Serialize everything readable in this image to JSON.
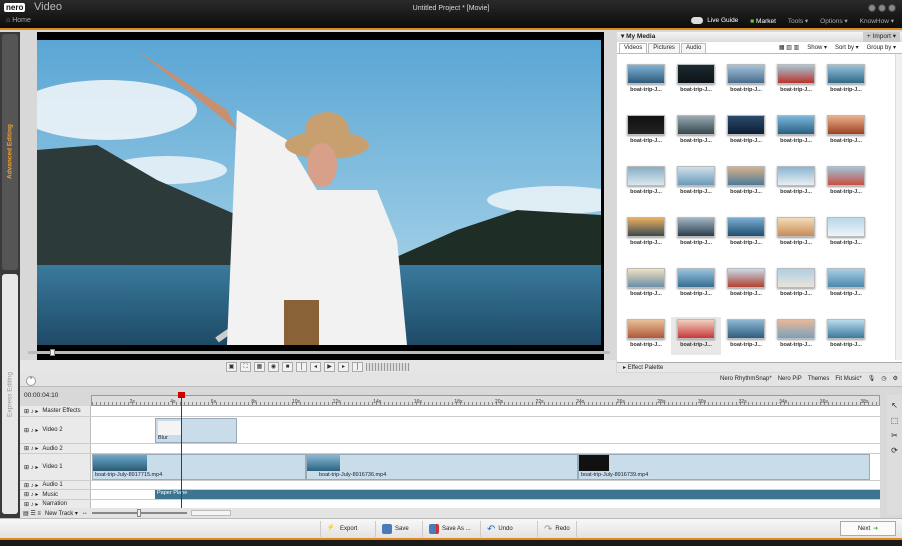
{
  "titlebar": {
    "brand": "nero",
    "app": "Video",
    "home": "Home",
    "window_title": "Untitled Project * [Movie]",
    "menu": [
      "Live Guide",
      "Market",
      "Tools ▾",
      "Options ▾",
      "KnowHow ▾"
    ]
  },
  "left_tabs": {
    "advanced": "Advanced Editing",
    "express": "Express Editing"
  },
  "media": {
    "title": "▾ My Media",
    "import": "+ Import ▾",
    "tabs": [
      "Videos",
      "Pictures",
      "Audio"
    ],
    "options": [
      "Show ▾",
      "Sort by ▾",
      "Group by ▾"
    ],
    "items": [
      {
        "label": "boat-trip-J...",
        "c1": "#7fb4d6",
        "c2": "#2e5a7a"
      },
      {
        "label": "boat-trip-J...",
        "c1": "#1c2a30",
        "c2": "#0c1418"
      },
      {
        "label": "boat-trip-J...",
        "c1": "#a8c4dc",
        "c2": "#476c8c"
      },
      {
        "label": "boat-trip-J...",
        "c1": "#a8c8d8",
        "c2": "#b8342a"
      },
      {
        "label": "boat-trip-J...",
        "c1": "#98c4de",
        "c2": "#2e6a86"
      },
      {
        "label": "boat-trip-J...",
        "c1": "#111",
        "c2": "#222"
      },
      {
        "label": "boat-trip-J...",
        "c1": "#9aaab0",
        "c2": "#34484e"
      },
      {
        "label": "boat-trip-J...",
        "c1": "#2a4a6c",
        "c2": "#0c1e34"
      },
      {
        "label": "boat-trip-J...",
        "c1": "#7ab8dc",
        "c2": "#2a5e80"
      },
      {
        "label": "boat-trip-J...",
        "c1": "#e8b08a",
        "c2": "#a04024"
      },
      {
        "label": "boat-trip-J...",
        "c1": "#88aec4",
        "c2": "#d8e8ee"
      },
      {
        "label": "boat-trip-J...",
        "c1": "#cfe0ea",
        "c2": "#6a9ab8"
      },
      {
        "label": "boat-trip-J...",
        "c1": "#d8b08a",
        "c2": "#4a7a9a"
      },
      {
        "label": "boat-trip-J...",
        "c1": "#8ab6d2",
        "c2": "#e8eef2"
      },
      {
        "label": "boat-trip-J...",
        "c1": "#a0c4dc",
        "c2": "#c85040"
      },
      {
        "label": "boat-trip-J...",
        "c1": "#e8b060",
        "c2": "#3a4a52"
      },
      {
        "label": "boat-trip-J...",
        "c1": "#a0b4c4",
        "c2": "#2c3e4c"
      },
      {
        "label": "boat-trip-J...",
        "c1": "#7aaed0",
        "c2": "#1e4e70"
      },
      {
        "label": "boat-trip-J...",
        "c1": "#f4dcb8",
        "c2": "#c88a58"
      },
      {
        "label": "boat-trip-J...",
        "c1": "#b8d8ea",
        "c2": "#eef4f8"
      },
      {
        "label": "boat-trip-J...",
        "c1": "#f0e0c0",
        "c2": "#6a8ea8"
      },
      {
        "label": "boat-trip-J...",
        "c1": "#98c4e0",
        "c2": "#386e92"
      },
      {
        "label": "boat-trip-J...",
        "c1": "#c8dcea",
        "c2": "#b04030"
      },
      {
        "label": "boat-trip-J...",
        "c1": "#b0cee2",
        "c2": "#e8e4dc"
      },
      {
        "label": "boat-trip-J...",
        "c1": "#a8d0e6",
        "c2": "#4e88aa"
      },
      {
        "label": "boat-trip-J...",
        "c1": "#e8c098",
        "c2": "#b05838"
      },
      {
        "label": "boat-trip-J...",
        "c1": "#f0d0c0",
        "c2": "#c83838"
      },
      {
        "label": "boat-trip-J...",
        "c1": "#8eb8d4",
        "c2": "#2e5e80"
      },
      {
        "label": "boat-trip-J...",
        "c1": "#e8b898",
        "c2": "#7aa0bc"
      },
      {
        "label": "boat-trip-J...",
        "c1": "#b8dcec",
        "c2": "#3a7a9c"
      }
    ],
    "selected_index": 26
  },
  "effect_palette": "▸ Effect Palette",
  "timeline": {
    "timecode": "00:00:04:10",
    "buttons": [
      "Nero RhythmSnap*",
      "Nero PiP",
      "Themes",
      "Fit Music*"
    ],
    "ticks": [
      "2s",
      "4s",
      "6s",
      "8s",
      "10s",
      "12s",
      "14s",
      "16s",
      "18s",
      "20s",
      "22s",
      "24s",
      "26s",
      "28s",
      "30s",
      "32s",
      "34s",
      "36s",
      "38s"
    ],
    "tracks": {
      "master": "Master Effects",
      "video2": "Video 2",
      "audio2": "Audio 2",
      "video1": "Video 1",
      "audio1": "Audio 1",
      "music": "Music",
      "narration": "Narration"
    },
    "clips": {
      "blur": "Blur",
      "v1a": "boat-trip-July-8917715.mp4",
      "v1b": "boat-trip-July-8916736.mp4",
      "v1c": "boat-trip-July-8916739.mp4",
      "music": "Paper Plane"
    },
    "new_track": "New Track ▾"
  },
  "bottom": {
    "export": "Export",
    "save": "Save",
    "save_as": "Save As ...",
    "undo": "Undo",
    "redo": "Redo",
    "next": "Next"
  },
  "colors": {
    "accent": "#e08a1e",
    "music_clip": "#3d7590",
    "video_clip": "#c8dcea"
  }
}
